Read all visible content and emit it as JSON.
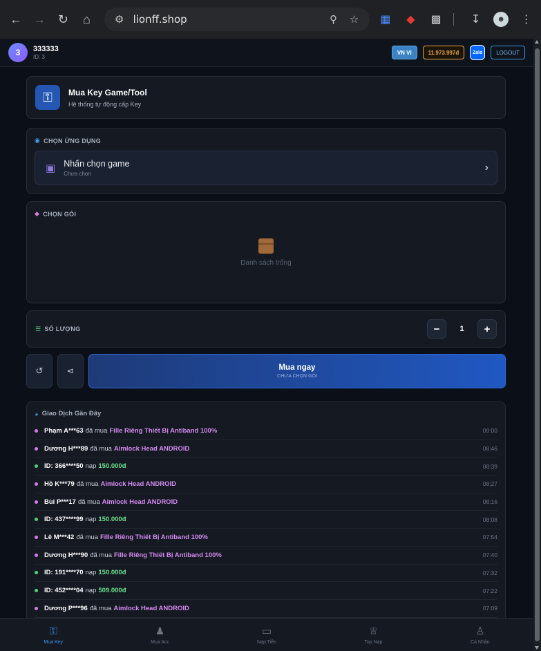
{
  "browser": {
    "url": "lionff.shop"
  },
  "header": {
    "avatar_letter": "3",
    "username": "333333",
    "user_id": "ID: 3",
    "lang_label": "VN VI",
    "balance": "11.973.997đ",
    "zalo_label": "Zalo",
    "logout_label": "LOGOUT"
  },
  "hero": {
    "title": "Mua Key Game/Tool",
    "subtitle": "Hệ thống tự động cấp Key"
  },
  "app_select": {
    "label": "CHỌN ỨNG DỤNG",
    "picker_title": "Nhấn chọn game",
    "picker_sub": "Chưa chọn"
  },
  "package": {
    "label": "CHỌN GÓI",
    "empty_text": "Danh sách trống"
  },
  "quantity": {
    "label": "SỐ LƯỢNG",
    "value": "1"
  },
  "buy": {
    "title": "Mua ngay",
    "subtitle": "CHƯA CHỌN GÓI"
  },
  "transactions": {
    "title": "Giao Dịch Gần Đây",
    "rows": [
      {
        "type": "buy",
        "who": "Phạm A***63",
        "verb": "đã mua",
        "item": "Fille Riêng Thiết Bị Antiband 100%",
        "time": "09:00"
      },
      {
        "type": "buy",
        "who": "Dương H***89",
        "verb": "đã mua",
        "item": "Aimlock Head ANDROID",
        "time": "08:46"
      },
      {
        "type": "dep",
        "who": "ID: 366****50",
        "verb": "nạp",
        "item": "150.000đ",
        "time": "08:39"
      },
      {
        "type": "buy",
        "who": "Hồ K***79",
        "verb": "đã mua",
        "item": "Aimlock Head ANDROID",
        "time": "08:27"
      },
      {
        "type": "buy",
        "who": "Bùi P***17",
        "verb": "đã mua",
        "item": "Aimlock Head ANDROID",
        "time": "08:16"
      },
      {
        "type": "dep",
        "who": "ID: 437****99",
        "verb": "nạp",
        "item": "150.000đ",
        "time": "08:08"
      },
      {
        "type": "buy",
        "who": "Lê M***42",
        "verb": "đã mua",
        "item": "Fille Riêng Thiết Bị Antiband 100%",
        "time": "07:54"
      },
      {
        "type": "buy",
        "who": "Dương H***90",
        "verb": "đã mua",
        "item": "Fille Riêng Thiết Bị Antiband 100%",
        "time": "07:40"
      },
      {
        "type": "dep",
        "who": "ID: 191****70",
        "verb": "nạp",
        "item": "150.000đ",
        "time": "07:32"
      },
      {
        "type": "dep",
        "who": "ID: 452****04",
        "verb": "nạp",
        "item": "509.000đ",
        "time": "07:22"
      },
      {
        "type": "buy",
        "who": "Dương P***96",
        "verb": "đã mua",
        "item": "Aimlock Head ANDROID",
        "time": "07:09"
      }
    ]
  },
  "bottom_nav": [
    {
      "label": "Mua Key",
      "icon": "key-icon",
      "active": true
    },
    {
      "label": "Mua Acc",
      "icon": "users-icon",
      "active": false
    },
    {
      "label": "Nạp Tiền",
      "icon": "wallet-icon",
      "active": false
    },
    {
      "label": "Top Nạp",
      "icon": "trophy-icon",
      "active": false
    },
    {
      "label": "Cá Nhân",
      "icon": "user-icon",
      "active": false
    }
  ],
  "colors": {
    "accent": "#3b9cf5",
    "balance": "#f0a94a",
    "item": "#d58bf0",
    "deposit": "#6be08e"
  }
}
